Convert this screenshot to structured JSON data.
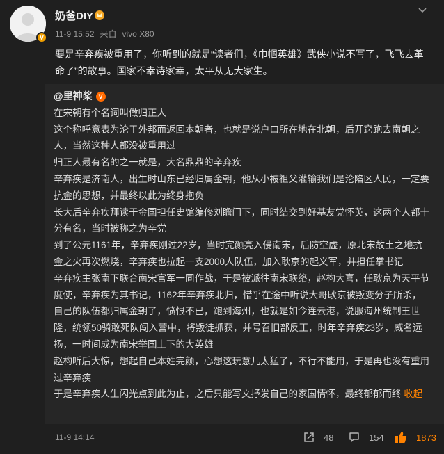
{
  "post": {
    "username": "奶爸DIY",
    "time": "11-9 15:52",
    "source_prefix": "来自",
    "source": "vivo X80",
    "text": "要是辛弃疾被重用了，你听到的就是“读者们，《巾帼英雄》武侠小说不写了，飞飞去革命了”的故事。国家不幸诗家幸，太平从无大家生。"
  },
  "repost": {
    "mention": "@里神桨",
    "paragraphs": [
      "在宋朝有个名词叫做归正人",
      "这个称呼意表为沦于外邦而返回本朝者，也就是说户口所在地在北朝，后开窍跑去南朝之人，当然这种人都没被重用过",
      "归正人最有名的之一就是，大名鼎鼎的辛弃疾",
      "辛弃疾是济南人，出生时山东已经归属金朝，他从小被祖父灌输我们是沦陷区人民，一定要抗金的思想，并最终以此为终身抱负",
      "长大后辛弃疾拜读于金国担任史馆编修刘瞻门下，同时结交到好基友党怀英，这两个人都十分有名，当时被称之为辛党",
      "到了公元1161年，辛弃疾刚过22岁，当时完颜亮入侵南宋，后防空虚，原北宋故土之地抗金之火再次燃烧，辛弃疾也拉起一支2000人队伍，加入耿京的起义军，并担任掌书记",
      "辛弃疾主张南下联合南宋官军一同作战，于是被派往南宋联络，赵构大喜，任耿京为天平节度使，辛弃疾为其书记，1162年辛弃疾北归，惜乎在途中听说大哥耿京被叛变分子所杀，自己的队伍都归属金朝了，愤恨不已，跑到海州，也就是如今连云港，说服海州统制王世隆，统领50骑敢死队闯入营中，将叛徒抓获，并号召旧部反正，时年辛弃疾23岁，威名远扬，一时间成为南宋举国上下的大英雄",
      "赵构听后大惊，想起自己本姓完颜，心想这玩意儿太猛了，不行不能用，于是再也没有重用过辛弃疾",
      "于是辛弃疾人生闪光点到此为止，之后只能写文抒发自己的家国情怀，最终郁郁而终 "
    ],
    "collapse_label": "收起",
    "time": "11-9 14:14"
  },
  "actions": {
    "share_count": "48",
    "comment_count": "154",
    "like_count": "1873"
  },
  "colors": {
    "accent": "#ff8200",
    "background": "#1f1f1f",
    "repost_bg": "#262626"
  }
}
